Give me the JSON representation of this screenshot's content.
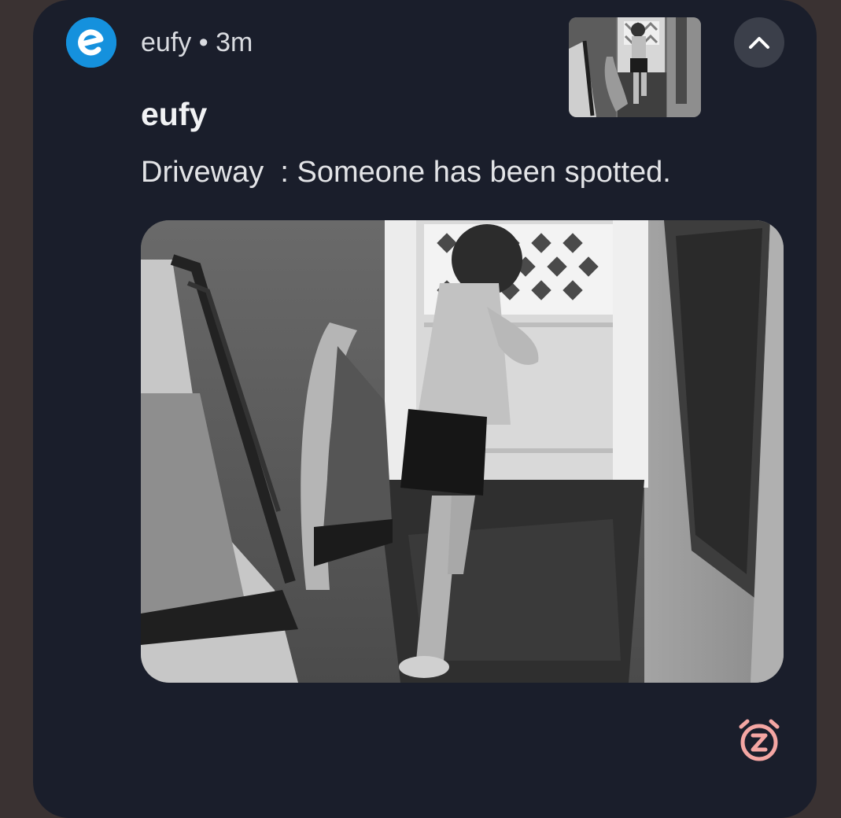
{
  "notification": {
    "app_name": "eufy",
    "separator": "•",
    "time_ago": "3m",
    "title": "eufy",
    "message": "Driveway  : Someone has been spotted.",
    "icons": {
      "app": "eufy-logo-icon",
      "expand": "chevron-up-icon",
      "snooze": "snooze-alarm-icon"
    },
    "colors": {
      "card_background": "#1a1e2b",
      "app_icon": "#1591dd",
      "snooze_accent": "#f4a6a3"
    }
  }
}
